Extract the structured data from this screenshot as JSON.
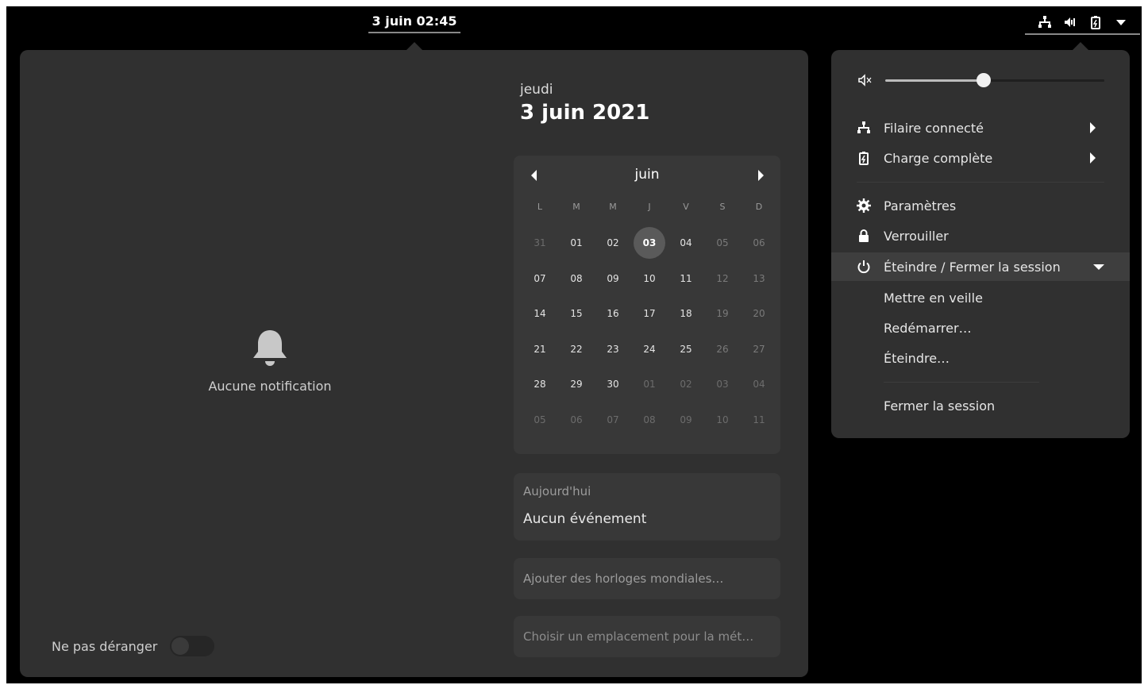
{
  "topbar": {
    "clock": "3 juin  02:45",
    "icons": [
      "network-wired-icon",
      "volume-icon",
      "battery-full-charging-icon",
      "chevron-down-icon"
    ]
  },
  "notifications": {
    "empty_label": "Aucune notification",
    "dnd_label": "Ne pas déranger",
    "dnd_on": false
  },
  "calendar": {
    "day_name": "jeudi",
    "full_date": "3 juin 2021",
    "month": "juin",
    "weekdays": [
      "L",
      "M",
      "M",
      "J",
      "V",
      "S",
      "D"
    ],
    "weeks": [
      [
        "31",
        "01",
        "02",
        "03",
        "04",
        "05",
        "06"
      ],
      [
        "07",
        "08",
        "09",
        "10",
        "11",
        "12",
        "13"
      ],
      [
        "14",
        "15",
        "16",
        "17",
        "18",
        "19",
        "20"
      ],
      [
        "21",
        "22",
        "23",
        "24",
        "25",
        "26",
        "27"
      ],
      [
        "28",
        "29",
        "30",
        "01",
        "02",
        "03",
        "04"
      ],
      [
        "05",
        "06",
        "07",
        "08",
        "09",
        "10",
        "11"
      ]
    ],
    "today": "03"
  },
  "events": {
    "heading": "Aujourd'hui",
    "text": "Aucun événement"
  },
  "world_clocks": "Ajouter des horloges mondiales…",
  "weather": "Choisir un emplacement pour la mét…",
  "system_menu": {
    "volume_level": 0.45,
    "items": {
      "wired": "Filaire connecté",
      "battery": "Charge complète",
      "settings": "Paramètres",
      "lock": "Verrouiller",
      "power": "Éteindre / Fermer la session",
      "suspend": "Mettre en veille",
      "restart": "Redémarrer…",
      "poweroff": "Éteindre…",
      "logout": "Fermer la session"
    }
  },
  "colors": {
    "panel": "#303030",
    "card": "#383838",
    "today_highlight": "#5a5a5a",
    "accent_text": "#ffffff"
  }
}
